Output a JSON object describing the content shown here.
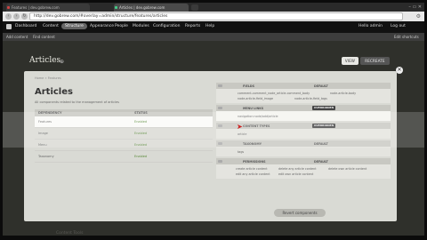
{
  "browser": {
    "tabs": [
      {
        "label": "Features | dev.gobrew.com"
      },
      {
        "label": "Articles | dev.gobrew.com"
      }
    ],
    "url": "http://dev.gobrew.com/#overlay=admin/structure/features/articles",
    "new_tab_icon": "plus-icon",
    "window_controls": "– ▭ ✕"
  },
  "toolbar": {
    "items": [
      "Dashboard",
      "Content",
      "Structure",
      "Appearance",
      "People",
      "Modules",
      "Configuration",
      "Reports",
      "Help"
    ],
    "active_index": 2,
    "user": "Hello admin",
    "logout": "Log out"
  },
  "shortcuts": {
    "items": [
      "Add content",
      "Find content"
    ],
    "edit": "Edit shortcuts"
  },
  "overlay": {
    "title": "Articles",
    "tabs": {
      "view": "VIEW",
      "recreate": "RECREATE"
    },
    "breadcrumb": "Home » Features",
    "page_title": "Articles",
    "description": "All components related to the management of articles",
    "dependency_table": {
      "headers": [
        "DEPENDENCY",
        "STATUS"
      ],
      "rows": [
        {
          "name": "Features",
          "status": "Enabled"
        },
        {
          "name": "Image",
          "status": "Enabled"
        },
        {
          "name": "Menu",
          "status": "Enabled"
        },
        {
          "name": "Taxonomy",
          "status": "Enabled"
        }
      ]
    },
    "components": {
      "fields": {
        "label": "FIELDS",
        "state": "DEFAULT",
        "lines": [
          [
            "comment-comment_node_article-comment_body",
            "node-article-body"
          ],
          [
            "node-article-field_image",
            "node-article-field_tags"
          ]
        ]
      },
      "menu_links": {
        "label": "MENU LINKS",
        "state": "OVERRIDDEN",
        "lines": [
          [
            "navigation:node/add/article"
          ]
        ]
      },
      "content_types": {
        "label": "CONTENT TYPES",
        "state": "OVERRIDDEN",
        "lines": [
          [
            "article"
          ]
        ]
      },
      "taxonomy": {
        "label": "TAXONOMY",
        "state": "DEFAULT",
        "lines": [
          [
            "tags"
          ]
        ]
      },
      "permissions": {
        "label": "PERMISSIONS",
        "state": "DEFAULT",
        "lines": [
          [
            "create article content",
            "delete any article content",
            "delete own article content"
          ],
          [
            "edit any article content",
            "edit own article content"
          ]
        ]
      }
    },
    "revert_button": "Revert components"
  },
  "background_text": "Content Tools",
  "colors": {
    "toolbar_bg": "#111111",
    "overlay_bg": "#d9dad4",
    "enabled_status": "#5a8a3a",
    "override_badge": "#444444",
    "arrow": "#cc2222"
  }
}
